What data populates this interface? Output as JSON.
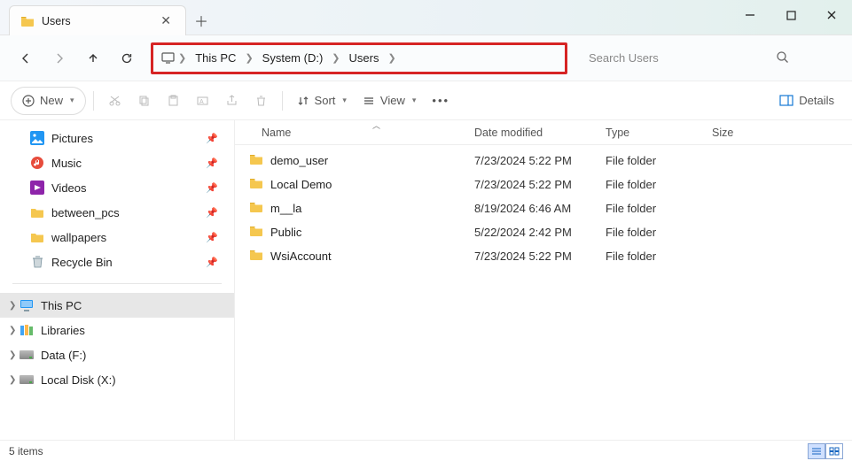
{
  "tab": {
    "title": "Users"
  },
  "breadcrumbs": {
    "a": "This PC",
    "b": "System (D:)",
    "c": "Users"
  },
  "search": {
    "placeholder": "Search Users"
  },
  "toolbar": {
    "new": "New",
    "sort": "Sort",
    "view": "View",
    "details": "Details"
  },
  "columns": {
    "name": "Name",
    "date": "Date modified",
    "type": "Type",
    "size": "Size"
  },
  "sidebar": {
    "items": [
      {
        "label": "Pictures"
      },
      {
        "label": "Music"
      },
      {
        "label": "Videos"
      },
      {
        "label": "between_pcs"
      },
      {
        "label": "wallpapers"
      },
      {
        "label": "Recycle Bin"
      }
    ],
    "nav": [
      {
        "label": "This PC"
      },
      {
        "label": "Libraries"
      },
      {
        "label": "Data (F:)"
      },
      {
        "label": "Local Disk (X:)"
      }
    ]
  },
  "rows": [
    {
      "name": "demo_user",
      "date": "7/23/2024 5:22 PM",
      "type": "File folder"
    },
    {
      "name": "Local Demo",
      "date": "7/23/2024 5:22 PM",
      "type": "File folder"
    },
    {
      "name": "m__la",
      "date": "8/19/2024 6:46 AM",
      "type": "File folder"
    },
    {
      "name": "Public",
      "date": "5/22/2024 2:42 PM",
      "type": "File folder"
    },
    {
      "name": "WsiAccount",
      "date": "7/23/2024 5:22 PM",
      "type": "File folder"
    }
  ],
  "status": {
    "count": "5 items"
  }
}
